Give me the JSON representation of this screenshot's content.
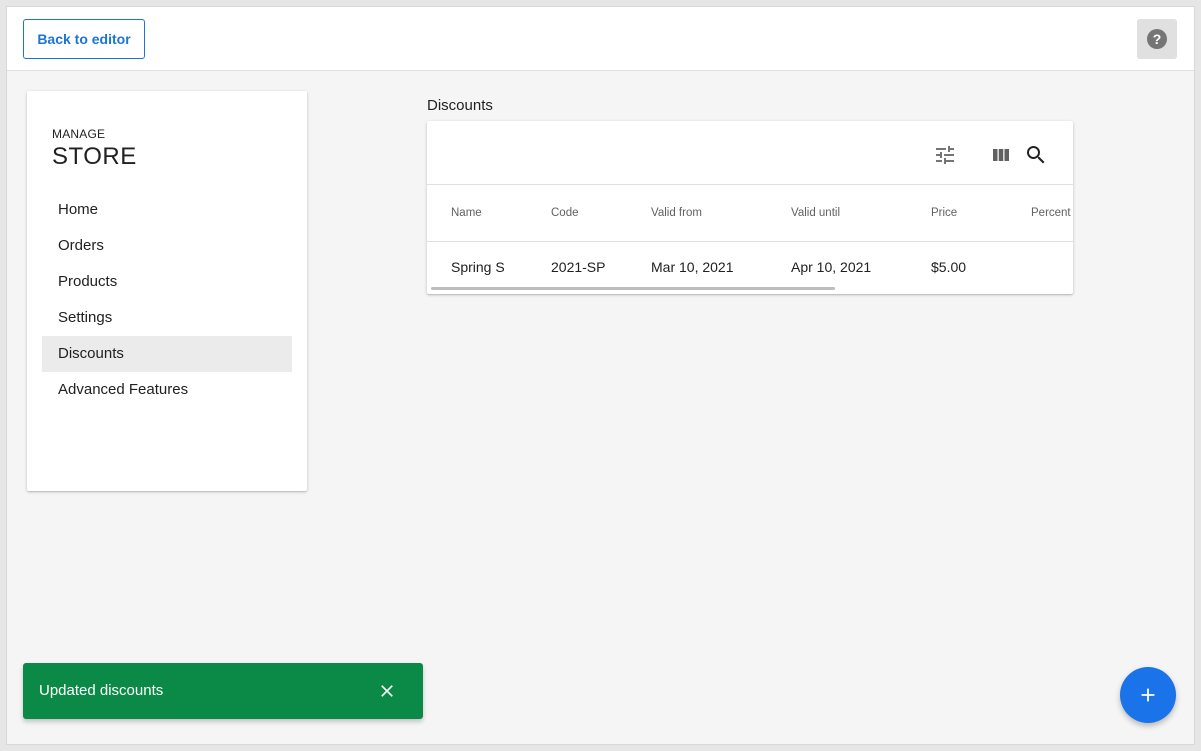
{
  "header": {
    "back_label": "Back to editor",
    "help_glyph": "?",
    "help_icon": "help-circle-icon"
  },
  "sidebar": {
    "subtitle": "MANAGE",
    "title": "STORE",
    "items": [
      {
        "label": "Home"
      },
      {
        "label": "Orders"
      },
      {
        "label": "Products"
      },
      {
        "label": "Settings"
      },
      {
        "label": "Discounts",
        "active": true
      },
      {
        "label": "Advanced Features"
      }
    ]
  },
  "main": {
    "section_title": "Discounts",
    "toolbar_icons": [
      "filter-icon",
      "columns-icon",
      "search-icon"
    ],
    "table": {
      "columns": [
        "Name",
        "Code",
        "Valid from",
        "Valid until",
        "Price",
        "Percent"
      ],
      "rows": [
        [
          "Spring S",
          "2021-SP",
          "Mar 10, 2021",
          "Apr 10, 2021",
          "$5.00",
          ""
        ]
      ]
    }
  },
  "snackbar": {
    "message": "Updated discounts",
    "color": "#0a8a46"
  },
  "fab": {
    "icon": "add-icon",
    "color": "#1a73e8"
  },
  "colors": {
    "primary": "#1976d2",
    "background": "#f5f5f5"
  }
}
